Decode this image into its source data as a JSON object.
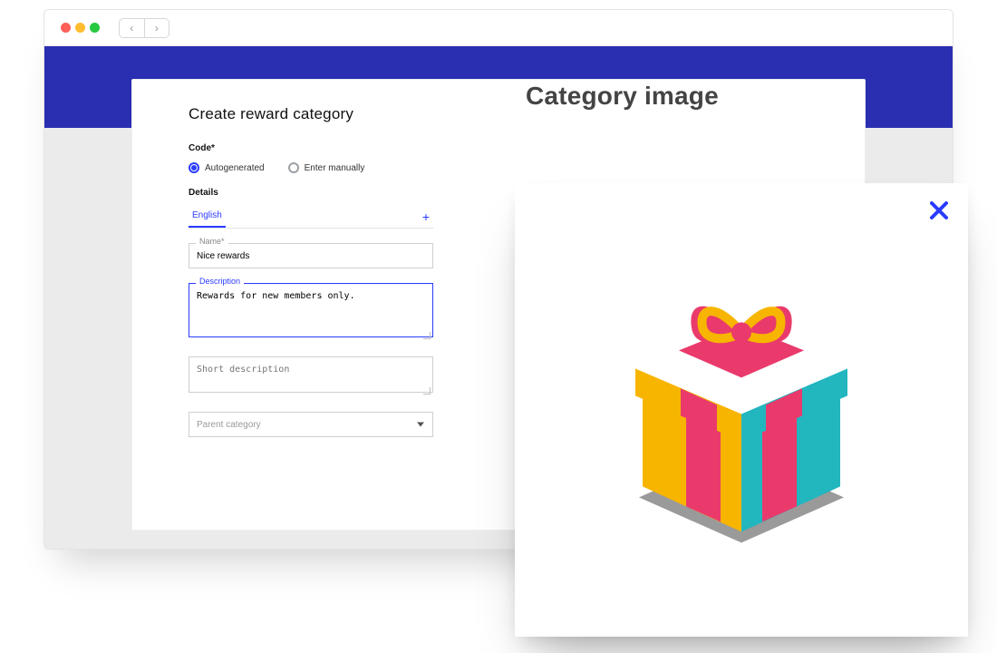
{
  "colors": {
    "brand": "#2a2fb2",
    "accent": "#2a3cff",
    "pink": "#ea3a6c",
    "yellow": "#f7b500",
    "teal": "#22b6bf",
    "gray": "#9a9a9a"
  },
  "window": {
    "nav_back": "‹",
    "nav_fwd": "›"
  },
  "form": {
    "title": "Create reward category",
    "code_label": "Code*",
    "options": {
      "autogen": "Autogenerated",
      "manual": "Enter manually",
      "selected": "autogen"
    },
    "details_label": "Details",
    "tab_label": "English",
    "name": {
      "label": "Name*",
      "value": "Nice rewards"
    },
    "description": {
      "label": "Description",
      "value": "Rewards for new members only. "
    },
    "short_desc": {
      "placeholder": "Short description"
    },
    "parent": {
      "placeholder": "Parent category"
    }
  },
  "preview": {
    "headline": "Category image",
    "image_semantic": "gift-box-isometric"
  }
}
